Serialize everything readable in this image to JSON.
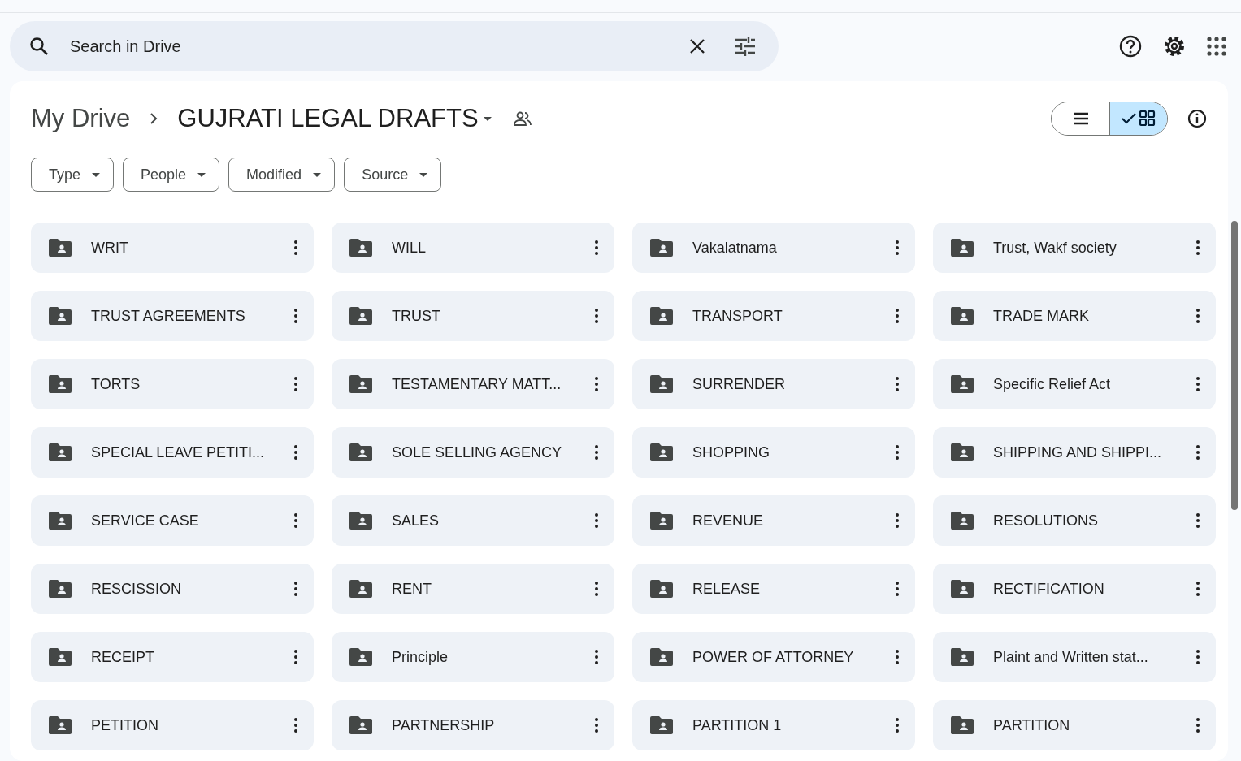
{
  "search": {
    "placeholder": "Search in Drive"
  },
  "breadcrumb": {
    "root": "My Drive",
    "current": "GUJRATI LEGAL DRAFTS"
  },
  "view_toggle": [
    {
      "kind": "list",
      "selected": false
    },
    {
      "kind": "grid",
      "selected": true
    }
  ],
  "filters": [
    "Type",
    "People",
    "Modified",
    "Source"
  ],
  "folders": [
    {
      "name": "WRIT"
    },
    {
      "name": "WILL"
    },
    {
      "name": "Vakalatnama"
    },
    {
      "name": "Trust, Wakf society"
    },
    {
      "name": "TRUST AGREEMENTS"
    },
    {
      "name": "TRUST"
    },
    {
      "name": "TRANSPORT"
    },
    {
      "name": "TRADE MARK"
    },
    {
      "name": "TORTS"
    },
    {
      "name": "TESTAMENTARY MATT..."
    },
    {
      "name": "SURRENDER"
    },
    {
      "name": "Specific Relief Act"
    },
    {
      "name": "SPECIAL LEAVE PETITI..."
    },
    {
      "name": "SOLE SELLING AGENCY"
    },
    {
      "name": "SHOPPING"
    },
    {
      "name": "SHIPPING AND SHIPPI..."
    },
    {
      "name": "SERVICE CASE"
    },
    {
      "name": "SALES"
    },
    {
      "name": "REVENUE"
    },
    {
      "name": "RESOLUTIONS"
    },
    {
      "name": "RESCISSION"
    },
    {
      "name": "RENT"
    },
    {
      "name": "RELEASE"
    },
    {
      "name": "RECTIFICATION"
    },
    {
      "name": "RECEIPT"
    },
    {
      "name": "Principle"
    },
    {
      "name": "POWER OF ATTORNEY"
    },
    {
      "name": "Plaint and Written stat..."
    },
    {
      "name": "PETITION"
    },
    {
      "name": "PARTNERSHIP"
    },
    {
      "name": "PARTITION 1"
    },
    {
      "name": "PARTITION"
    }
  ]
}
